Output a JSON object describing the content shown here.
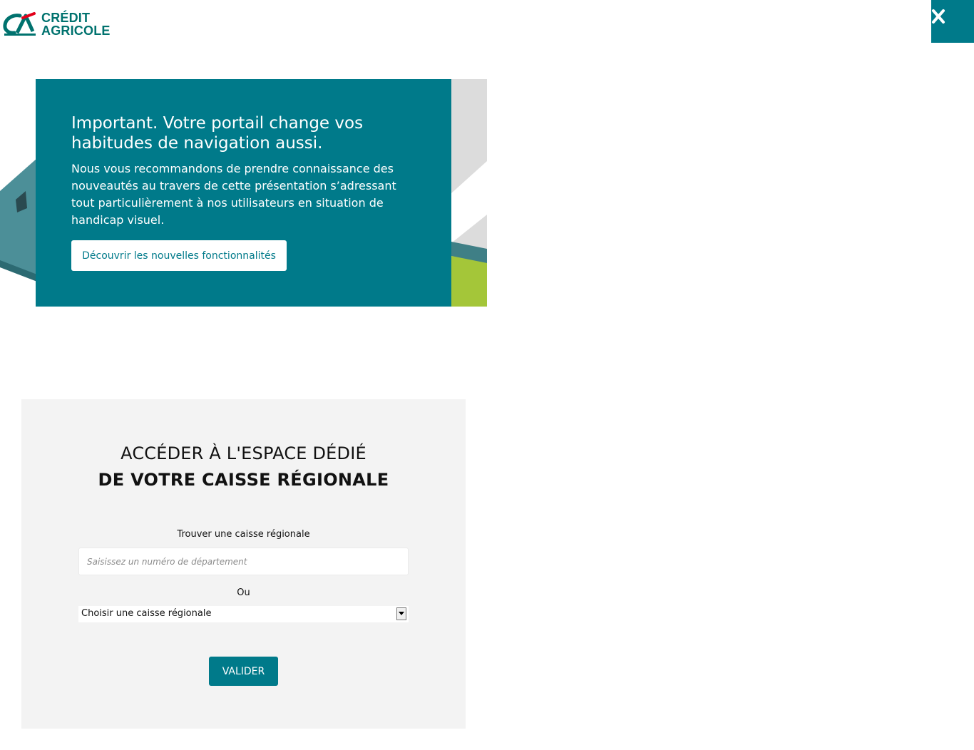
{
  "header": {
    "logo_line1": "CRÉDIT",
    "logo_line2": "AGRICOLE",
    "close_icon": "close-icon"
  },
  "promo": {
    "title": "Important. Votre portail change vos habitudes de navigation aussi.",
    "text": "Nous vous recommandons de prendre connaissance des nouveautés au travers de cette présentation s’adressant tout particulièrement à nos utilisateurs en situation de handicap visuel.",
    "button_label": "Découvrir les nouvelles fonctionnalités"
  },
  "region": {
    "title_line1": "ACCÉDER À L'ESPACE DÉDIÉ",
    "title_line2": "DE VOTRE CAISSE RÉGIONALE",
    "find_label": "Trouver une caisse régionale",
    "dept_placeholder": "Saisissez un numéro de département",
    "or_label": "Ou",
    "select_value": "Choisir une caisse régionale",
    "validate_label": "VALIDER"
  },
  "colors": {
    "brand_teal": "#007a8a",
    "logo_green": "#00726e",
    "logo_red": "#e2001a",
    "panel_grey": "#f3f3f3",
    "accent_green": "#a4c639"
  }
}
